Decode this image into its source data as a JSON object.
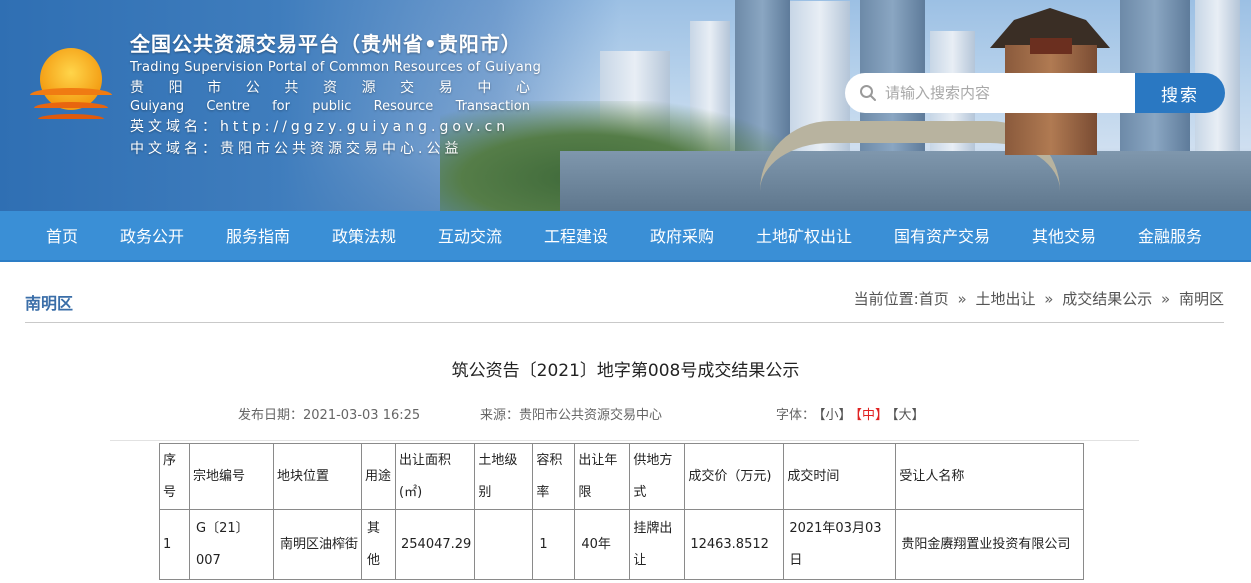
{
  "header": {
    "title_cn": "全国公共资源交易平台（贵州省•贵阳市）",
    "title_en": "Trading Supervision Portal of Common Resources of Guiyang",
    "centre_cn": [
      "贵",
      "阳",
      "市",
      "公",
      "共",
      "资",
      "源",
      "交",
      "易",
      "中",
      "心"
    ],
    "centre_en": [
      "Guiyang",
      "Centre",
      "for",
      "public",
      "Resource",
      "Transaction"
    ],
    "en_domain_label": "英文域名：",
    "en_domain_value": "http://ggzy.guiyang.gov.cn",
    "cn_domain_label": "中文域名：",
    "cn_domain_value": "贵阳市公共资源交易中心.公益"
  },
  "search": {
    "placeholder": "请输入搜索内容",
    "button_label": "搜索"
  },
  "nav": {
    "items": [
      "首页",
      "政务公开",
      "服务指南",
      "政策法规",
      "互动交流",
      "工程建设",
      "政府采购",
      "土地矿权出让",
      "国有资产交易",
      "其他交易",
      "金融服务"
    ]
  },
  "section": {
    "title": "南明区"
  },
  "breadcrumb": {
    "prefix": "当前位置:",
    "items": [
      "首页",
      "土地出让",
      "成交结果公示",
      "南明区"
    ],
    "separator": "»"
  },
  "article": {
    "title": "筑公资告〔2021〕地字第008号成交结果公示",
    "date_label": "发布日期：",
    "date_value": "2021-03-03 16:25",
    "source_label": "来源：",
    "source_value": "贵阳市公共资源交易中心",
    "font_label": "字体：",
    "font_small": "【小】",
    "font_mid": "【中】",
    "font_large": "【大】"
  },
  "table": {
    "headers": [
      "序号",
      "宗地编号",
      "地块位置",
      "用途",
      "出让面积(㎡)",
      "土地级别",
      "容积率",
      "出让年限",
      "供地方式",
      "成交价（万元)",
      "成交时间",
      "受让人名称"
    ],
    "rows": [
      [
        "1",
        "G〔21〕007",
        "南明区油榨街",
        "其他",
        "254047.29",
        "",
        "1",
        "40年",
        "挂牌出让",
        "12463.8512",
        "2021年03月03日",
        "贵阳金赓翔置业投资有限公司"
      ]
    ]
  },
  "colors": {
    "nav_bg": "#3a8fd6",
    "search_button": "#2a78c2",
    "section_title": "#3a6ea8",
    "font_mid_active": "#e02222"
  }
}
